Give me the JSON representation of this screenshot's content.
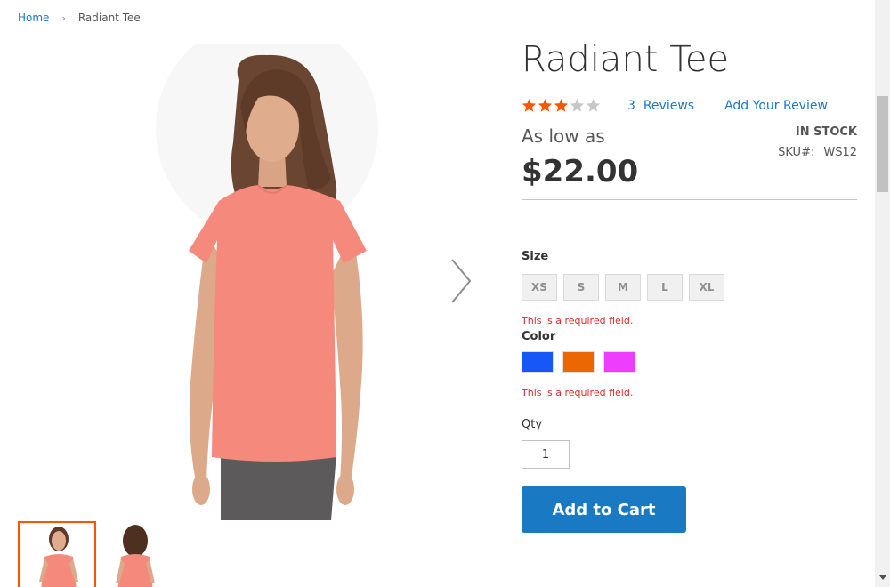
{
  "breadcrumb": {
    "home": "Home",
    "separator": "›",
    "current": "Radiant Tee"
  },
  "gallery": {
    "next_icon": "chevron-right-icon",
    "thumbnails": [
      "front-view",
      "back-view"
    ],
    "active_border_color": "#ff5501"
  },
  "product": {
    "title": "Radiant Tee",
    "rating": {
      "value": 3,
      "max": 5,
      "filled_color": "#ff5501",
      "empty_color": "#c7c7c7",
      "reviews_count": "3",
      "reviews_label": "Reviews",
      "add_review_label": "Add Your Review"
    },
    "price_prefix": "As low as",
    "price": "$22.00",
    "stock": "In stock",
    "sku_label": "SKU#:",
    "sku": "WS12"
  },
  "options": {
    "size_label": "Size",
    "sizes": [
      "XS",
      "S",
      "M",
      "L",
      "XL"
    ],
    "size_error": "This is a required field.",
    "color_label": "Color",
    "colors": [
      "#1857f7",
      "#eb6703",
      "#ef3dff"
    ],
    "color_error": "This is a required field.",
    "qty_label": "Qty",
    "qty_value": "1"
  },
  "actions": {
    "add_to_cart": "Add to Cart",
    "button_color": "#1979c3"
  }
}
